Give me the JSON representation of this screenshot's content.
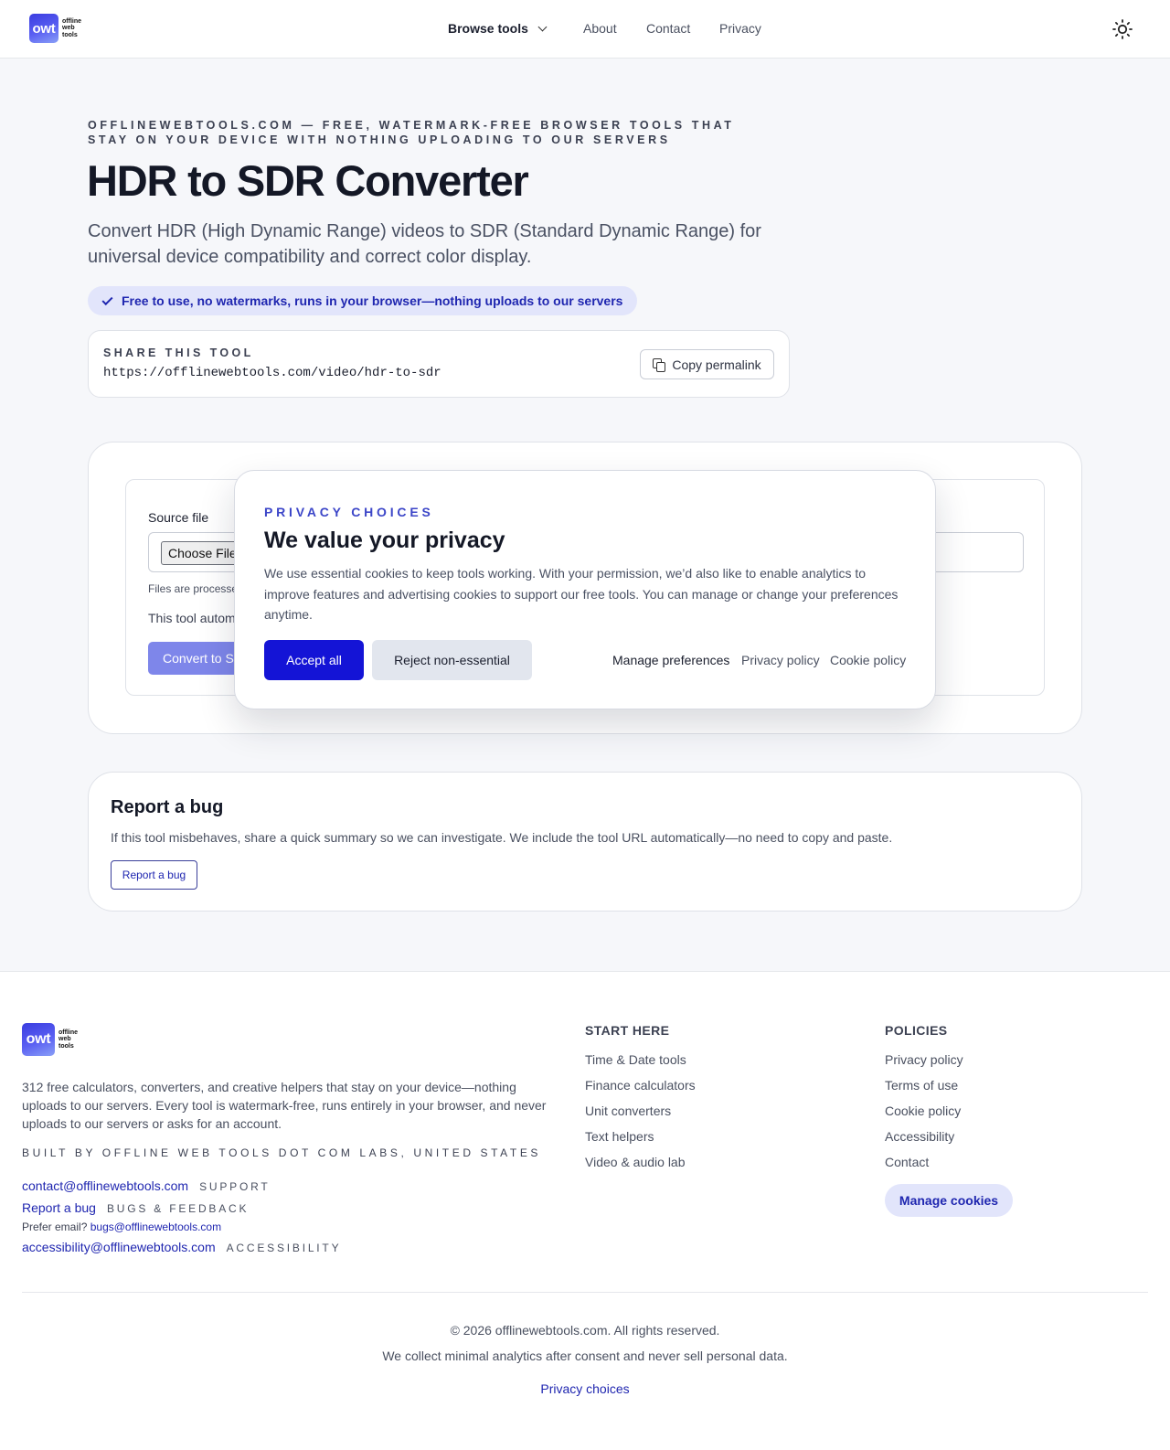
{
  "header": {
    "logo_mark": "owt",
    "logo_words": [
      "offline",
      "web",
      "tools"
    ],
    "nav": {
      "browse": "Browse tools",
      "about": "About",
      "contact": "Contact",
      "privacy": "Privacy"
    },
    "theme_icon": "sun-icon"
  },
  "hero": {
    "eyebrow": "OFFLINEWEBTOOLS.COM — FREE, WATERMARK-FREE BROWSER TOOLS THAT STAY ON YOUR DEVICE WITH NOTHING UPLOADING TO OUR SERVERS",
    "title": "HDR to SDR Converter",
    "description": "Convert HDR (High Dynamic Range) videos to SDR (Standard Dynamic Range) for universal device compatibility and correct color display.",
    "pill": "Free to use, no watermarks, runs in your browser—nothing uploads to our servers"
  },
  "share": {
    "label": "SHARE THIS TOOL",
    "url": "https://offlinewebtools.com/video/hdr-to-sdr",
    "copy_label": "Copy permalink"
  },
  "tool": {
    "source_label": "Source file",
    "choose_label": "Choose File",
    "files_note": "Files are processe",
    "auto_note": "This tool autom",
    "convert_label": "Convert to S"
  },
  "modal": {
    "eyebrow": "PRIVACY CHOICES",
    "title": "We value your privacy",
    "body": "We use essential cookies to keep tools working. With your permission, we’d also like to enable analytics to improve features and advertising cookies to support our free tools. You can manage or change your preferences anytime.",
    "accept": "Accept all",
    "reject": "Reject non-essential",
    "manage": "Manage preferences",
    "privacy_policy": "Privacy policy",
    "cookie_policy": "Cookie policy"
  },
  "bug": {
    "title": "Report a bug",
    "description": "If this tool misbehaves, share a quick summary so we can investigate. We include the tool URL automatically—no need to copy and paste.",
    "button": "Report a bug"
  },
  "footer": {
    "about": "312 free calculators, converters, and creative helpers that stay on your device—nothing uploads to our servers. Every tool is watermark-free, runs entirely in your browser, and never uploads to our servers or asks for an account.",
    "built_by": "BUILT BY OFFLINE WEB TOOLS DOT COM LABS, UNITED STATES",
    "contact_email": "contact@offlinewebtools.com",
    "contact_tag": "SUPPORT",
    "report_link": "Report a bug",
    "report_tag": "BUGS & FEEDBACK",
    "prefer_email_label": "Prefer email?",
    "bugs_email": "bugs@offlinewebtools.com",
    "a11y_email": "accessibility@offlinewebtools.com",
    "a11y_tag": "ACCESSIBILITY",
    "start_here": {
      "heading": "START HERE",
      "items": [
        "Time & Date tools",
        "Finance calculators",
        "Unit converters",
        "Text helpers",
        "Video & audio lab"
      ]
    },
    "policies": {
      "heading": "POLICIES",
      "items": [
        "Privacy policy",
        "Terms of use",
        "Cookie policy",
        "Accessibility",
        "Contact"
      ]
    },
    "manage_cookies": "Manage cookies",
    "copyright": "© 2026 offlinewebtools.com. All rights reserved.",
    "analytics_note": "We collect minimal analytics after consent and never sell personal data.",
    "privacy_choices": "Privacy choices"
  },
  "colors": {
    "accent": "#1414d6",
    "link": "#1f26b0",
    "pill_bg": "#e2e5fb"
  }
}
